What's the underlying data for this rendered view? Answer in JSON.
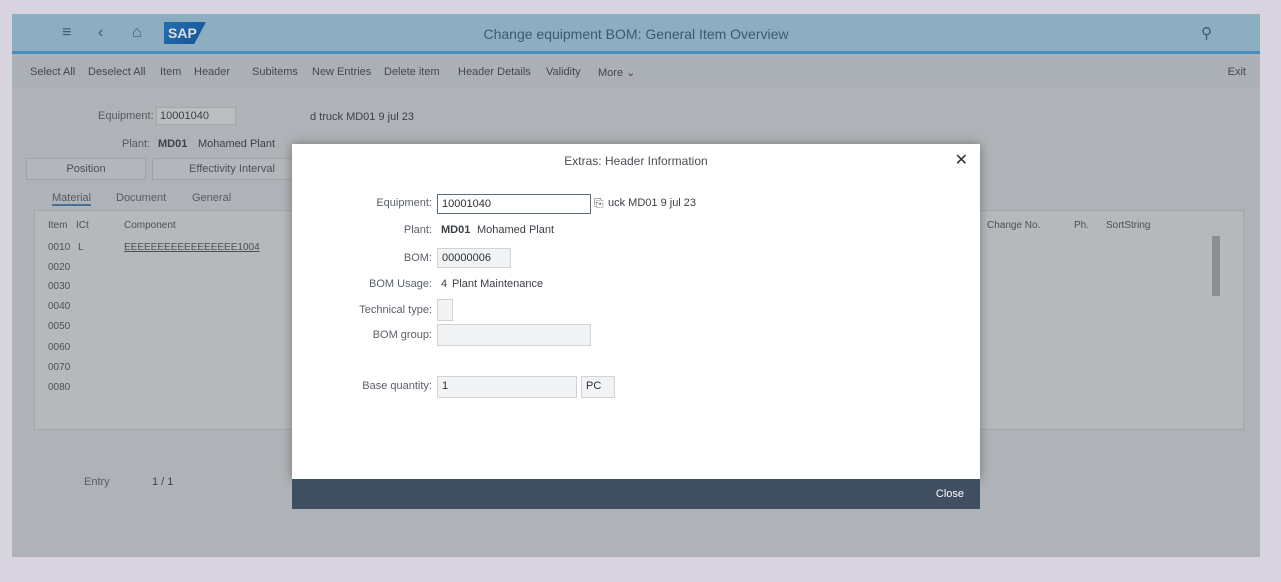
{
  "shell": {
    "title": "Change equipment BOM: General Item Overview",
    "logo": "SAP",
    "icons": [
      "menu-icon",
      "back-icon",
      "home-icon",
      "search-icon"
    ]
  },
  "toolbar": {
    "items": [
      "Select All",
      "Deselect All",
      "Item",
      "Header",
      "Subitems",
      "New Entries",
      "Delete item",
      "Header Details",
      "Validity",
      "More ⌄"
    ],
    "exit": "Exit"
  },
  "background": {
    "equipment_label": "Equipment:",
    "equipment_value": "10001040",
    "equipment_desc": "d truck MD01 9 jul 23",
    "plant_label": "Plant:",
    "plant_value": "MD01",
    "plant_desc": "Mohamed Plant",
    "tabs": [
      "Position",
      "Effectivity Interval"
    ],
    "subtabs": [
      "Material",
      "Document",
      "General"
    ],
    "table_headers": [
      "Item",
      "ICt",
      "Component",
      "Change No.",
      "Ph.",
      "SortString"
    ],
    "rows": [
      {
        "item": "0010",
        "ict": "L",
        "component": "EEEEEEEEEEEEEEEEE1004"
      },
      {
        "item": "0020",
        "ict": "",
        "component": ""
      },
      {
        "item": "0030",
        "ict": "",
        "component": ""
      },
      {
        "item": "0040",
        "ict": "",
        "component": ""
      },
      {
        "item": "0050",
        "ict": "",
        "component": ""
      },
      {
        "item": "0060",
        "ict": "",
        "component": ""
      },
      {
        "item": "0070",
        "ict": "",
        "component": ""
      },
      {
        "item": "0080",
        "ict": "",
        "component": ""
      }
    ],
    "entry_label": "Entry",
    "entry_value": "1 / 1"
  },
  "dialog": {
    "title": "Extras: Header Information",
    "equipment_label": "Equipment:",
    "equipment_value": "10001040",
    "equipment_desc": "uck MD01 9 jul 23",
    "plant_label": "Plant:",
    "plant_value": "MD01",
    "plant_desc": "Mohamed Plant",
    "bom_label": "BOM:",
    "bom_value": "00000006",
    "bom_usage_label": "BOM Usage:",
    "bom_usage_value": "4",
    "bom_usage_desc": "Plant Maintenance",
    "tech_type_label": "Technical type:",
    "tech_type_value": "",
    "bom_group_label": "BOM group:",
    "bom_group_value": "",
    "base_qty_label": "Base quantity:",
    "base_qty_value": "1",
    "base_qty_unit": "PC",
    "close_label": "Close"
  }
}
